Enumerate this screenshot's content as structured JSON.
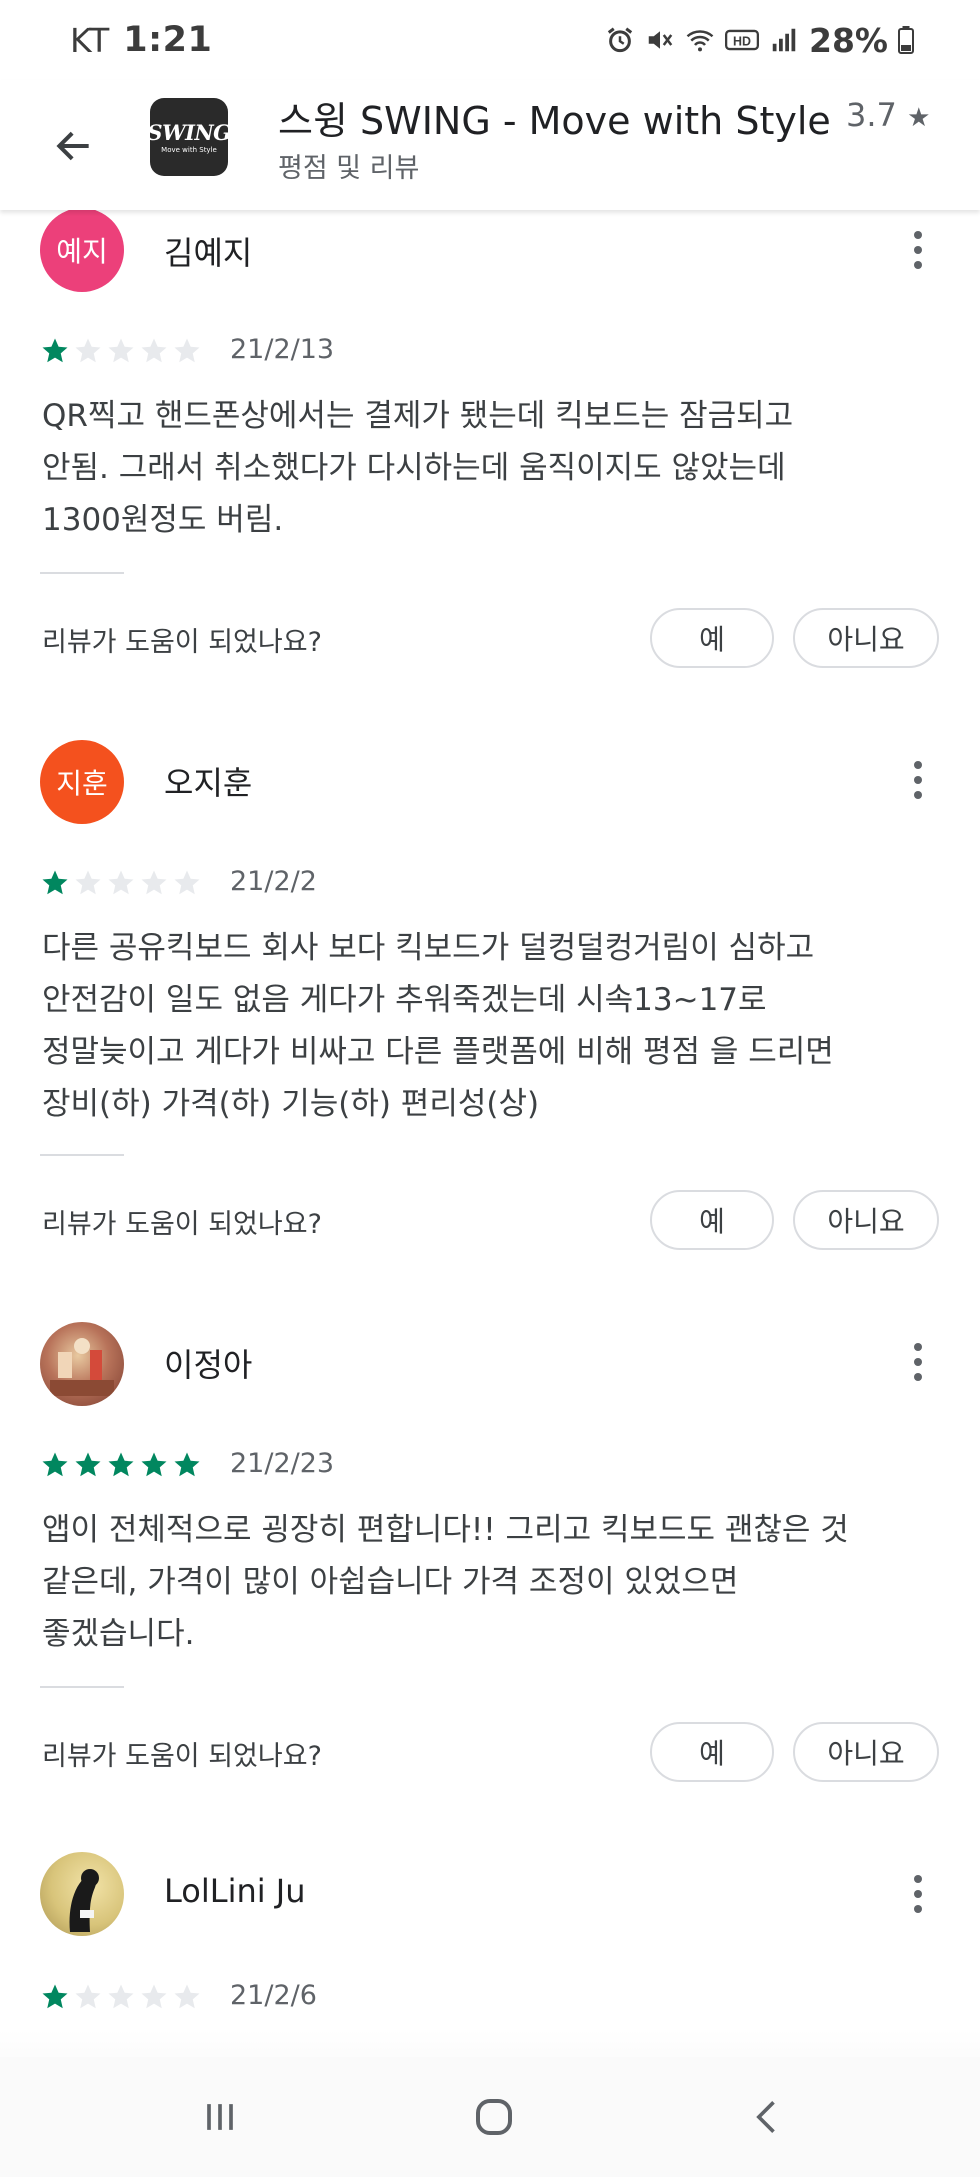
{
  "status_bar": {
    "carrier": "KT",
    "time": "1:21",
    "battery": "28%",
    "icons": [
      "alarm-icon",
      "mute-icon",
      "wifi-icon",
      "hd-icon",
      "signal-icon",
      "battery-icon"
    ]
  },
  "header": {
    "app_title": "스윙 SWING - Move with Style",
    "rating": "3.7",
    "subtitle": "평점 및 리뷰",
    "logo_main": "SWING",
    "logo_sub": "Move with Style"
  },
  "reviews": [
    {
      "name": "김예지",
      "avatar_text": "예지",
      "avatar_color": "#ec407a",
      "stars": 1,
      "date": "21/2/13",
      "text": "QR찍고 핸드폰상에서는 결제가 됐는데 킥보드는 잠금되고\n안됨. 그래서 취소했다가 다시하는데 움직이지도 않았는데\n1300원정도 버림.",
      "helpful_question": "리뷰가 도움이 되었나요?",
      "yes": "예",
      "no": "아니요"
    },
    {
      "name": "오지훈",
      "avatar_text": "지훈",
      "avatar_color": "#f4511e",
      "stars": 1,
      "date": "21/2/2",
      "text": "다른 공유킥보드 회사 보다 킥보드가 덜컹덜컹거림이 심하고\n안전감이 일도 없음 게다가 추워죽겠는데 시속13~17로\n정말늦이고 게다가 비싸고 다른 플랫폼에 비해 평점 을 드리면\n장비(하) 가격(하) 기능(하) 편리성(상)",
      "helpful_question": "리뷰가 도움이 되었나요?",
      "yes": "예",
      "no": "아니요"
    },
    {
      "name": "이정아",
      "avatar_text": "",
      "avatar_color": "#b8735a",
      "stars": 5,
      "date": "21/2/23",
      "text": "앱이 전체적으로 굉장히 편합니다!! 그리고 킥보드도 괜찮은 것\n같은데, 가격이 많이 아쉽습니다 가격 조정이 있었으면\n좋겠습니다.",
      "helpful_question": "리뷰가 도움이 되었나요?",
      "yes": "예",
      "no": "아니요"
    },
    {
      "name": "LolLini Ju",
      "avatar_text": "",
      "avatar_color": "#d8c47a",
      "stars": 1,
      "date": "21/2/6",
      "text": "",
      "helpful_question": "",
      "yes": "",
      "no": ""
    }
  ],
  "colors": {
    "star_filled": "#01875f",
    "star_empty": "#e8eaed"
  }
}
